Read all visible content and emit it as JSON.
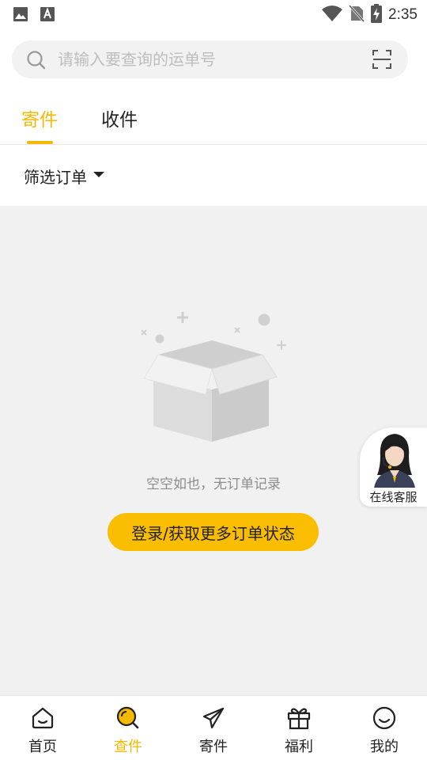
{
  "status_bar": {
    "time": "2:35"
  },
  "search": {
    "placeholder": "请输入要查询的运单号"
  },
  "tabs": [
    {
      "label": "寄件",
      "active": true
    },
    {
      "label": "收件",
      "active": false
    }
  ],
  "filter": {
    "label": "筛选订单"
  },
  "empty_state": {
    "message": "空空如也，无订单记录",
    "button_label": "登录/获取更多订单状态"
  },
  "service": {
    "label": "在线客服"
  },
  "bottom_nav": [
    {
      "label": "首页",
      "icon": "home-icon"
    },
    {
      "label": "查件",
      "icon": "search-icon",
      "active": true
    },
    {
      "label": "寄件",
      "icon": "paper-plane-icon"
    },
    {
      "label": "福利",
      "icon": "gift-icon"
    },
    {
      "label": "我的",
      "icon": "smile-icon"
    }
  ],
  "colors": {
    "accent": "#f5b800",
    "button": "#fbbd00",
    "content_bg": "#f1f1f1"
  }
}
